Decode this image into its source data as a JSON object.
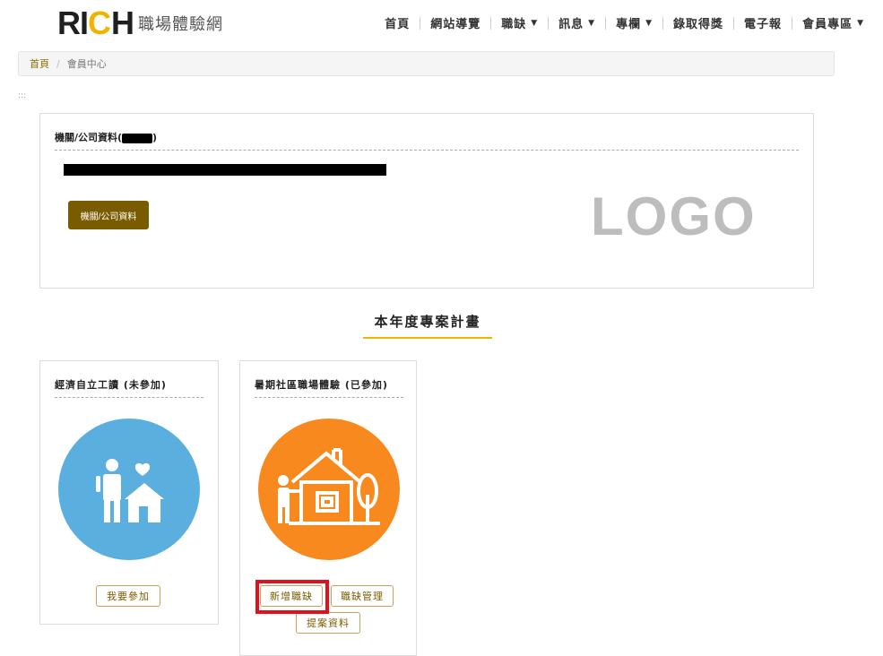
{
  "header": {
    "logo_r": "RI",
    "logo_c": "C",
    "logo_h": "H",
    "logo_sub": "職場體驗網",
    "nav": [
      {
        "label": "首頁",
        "dropdown": false
      },
      {
        "label": "網站導覽",
        "dropdown": false
      },
      {
        "label": "職缺",
        "dropdown": true
      },
      {
        "label": "訊息",
        "dropdown": true
      },
      {
        "label": "專欄",
        "dropdown": true
      },
      {
        "label": "錄取得獎",
        "dropdown": false
      },
      {
        "label": "電子報",
        "dropdown": false
      },
      {
        "label": "會員專區",
        "dropdown": true
      }
    ]
  },
  "breadcrumb": {
    "home": "首頁",
    "sep": "/",
    "current": "會員中心"
  },
  "anchor": ":::",
  "company": {
    "title_prefix": "機關/公司資料(",
    "title_suffix": ")",
    "button": "機關/公司資料",
    "logo_placeholder": "LOGO"
  },
  "section": {
    "title": "本年度專案計畫"
  },
  "plans": [
    {
      "title": "經濟自立工讀 (未參加)",
      "color": "#5aafdf",
      "icon": "person-family-home-icon",
      "buttons": [
        "我要參加"
      ]
    },
    {
      "title": "暑期社區職場體驗 (已參加)",
      "color": "#f7891f",
      "icon": "person-house-tree-icon",
      "buttons": [
        "新增職缺",
        "職缺管理",
        "提案資料"
      ]
    }
  ],
  "colors": {
    "accent": "#f0b400",
    "button_brown": "#7a5c00",
    "highlight_red": "#e0101c"
  }
}
